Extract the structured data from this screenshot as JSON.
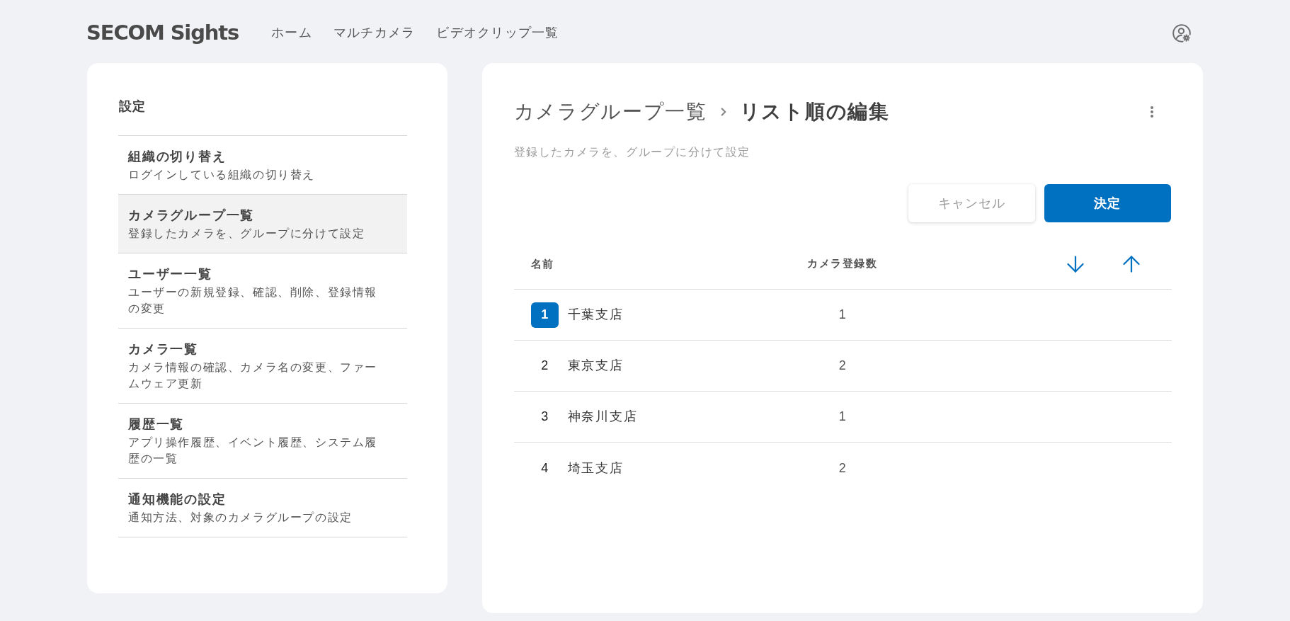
{
  "header": {
    "logo": "SECOM Sights",
    "nav": [
      {
        "label": "ホーム"
      },
      {
        "label": "マルチカメラ"
      },
      {
        "label": "ビデオクリップ一覧"
      }
    ]
  },
  "sidebar": {
    "title": "設定",
    "items": [
      {
        "title": "組織の切り替え",
        "description": "ログインしている組織の切り替え",
        "selected": false
      },
      {
        "title": "カメラグループ一覧",
        "description": "登録したカメラを、グループに分けて設定",
        "selected": true
      },
      {
        "title": "ユーザー一覧",
        "description": "ユーザーの新規登録、確認、削除、登録情報の変更",
        "selected": false
      },
      {
        "title": "カメラ一覧",
        "description": "カメラ情報の確認、カメラ名の変更、ファームウェア更新",
        "selected": false
      },
      {
        "title": "履歴一覧",
        "description": "アプリ操作履歴、イベント履歴、システム履歴の一覧",
        "selected": false
      },
      {
        "title": "通知機能の設定",
        "description": "通知方法、対象のカメラグループの設定",
        "selected": false
      }
    ]
  },
  "main": {
    "breadcrumb": [
      {
        "label": "カメラグループ一覧",
        "current": false
      },
      {
        "label": "リスト順の編集",
        "current": true
      }
    ],
    "subtitle": "登録したカメラを、グループに分けて設定",
    "buttons": [
      {
        "label": "キャンセル",
        "kind": "secondary"
      },
      {
        "label": "決定",
        "kind": "primary"
      }
    ],
    "table": {
      "columns": [
        "名前",
        "カメラ登録数"
      ],
      "rows": [
        {
          "number": "1",
          "name": "千葉支店",
          "cameras": "1",
          "selected": true
        },
        {
          "number": "2",
          "name": "東京支店",
          "cameras": "2",
          "selected": false
        },
        {
          "number": "3",
          "name": "神奈川支店",
          "cameras": "1",
          "selected": false
        },
        {
          "number": "4",
          "name": "埼玉支店",
          "cameras": "2",
          "selected": false
        }
      ]
    }
  }
}
